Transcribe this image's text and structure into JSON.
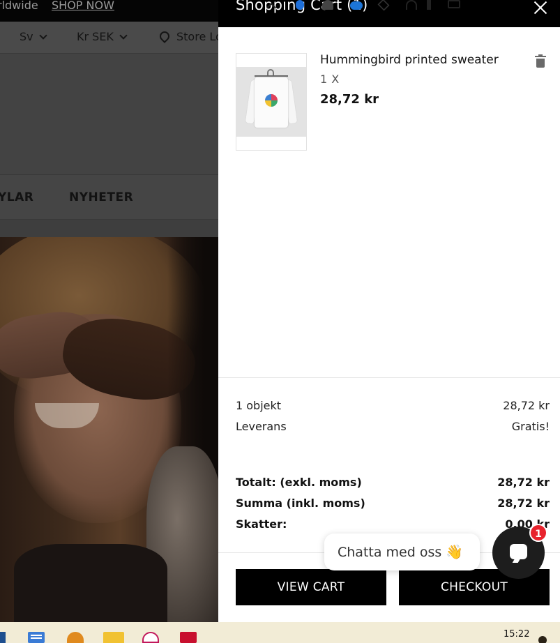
{
  "background": {
    "promo_text": "rldwide",
    "promo_link": "SHOP NOW",
    "language": "Sv",
    "currency": "Kr SEK",
    "store_locator": "Store Lo",
    "nav_items": [
      "YLAR",
      "NYHETER"
    ]
  },
  "cart": {
    "title": "Shopping Cart (1)",
    "item": {
      "name": "Hummingbird printed sweater",
      "quantity": "1 X",
      "price": "28,72 kr",
      "image_icon": "sweater-on-hanger"
    },
    "summary": {
      "items_label": "1 objekt",
      "items_value": "28,72 kr",
      "shipping_label": "Leverans",
      "shipping_value": "Gratis!",
      "total_excl_label": "Totalt: (exkl. moms)",
      "total_excl_value": "28,72 kr",
      "total_incl_label": "Summa (inkl. moms)",
      "total_incl_value": "28,72 kr",
      "taxes_label": "Skatter:",
      "taxes_value": "0,00 kr"
    },
    "view_cart_label": "VIEW CART",
    "checkout_label": "CHECKOUT"
  },
  "chat": {
    "bubble_text": "Chatta med oss",
    "wave_emoji": "👋",
    "badge_count": "1"
  },
  "taskbar": {
    "time": "15:22"
  },
  "colors": {
    "drawer_header": "#000000",
    "button": "#000000",
    "badge": "#e8232d",
    "taskbar": "#f2ecd6"
  }
}
